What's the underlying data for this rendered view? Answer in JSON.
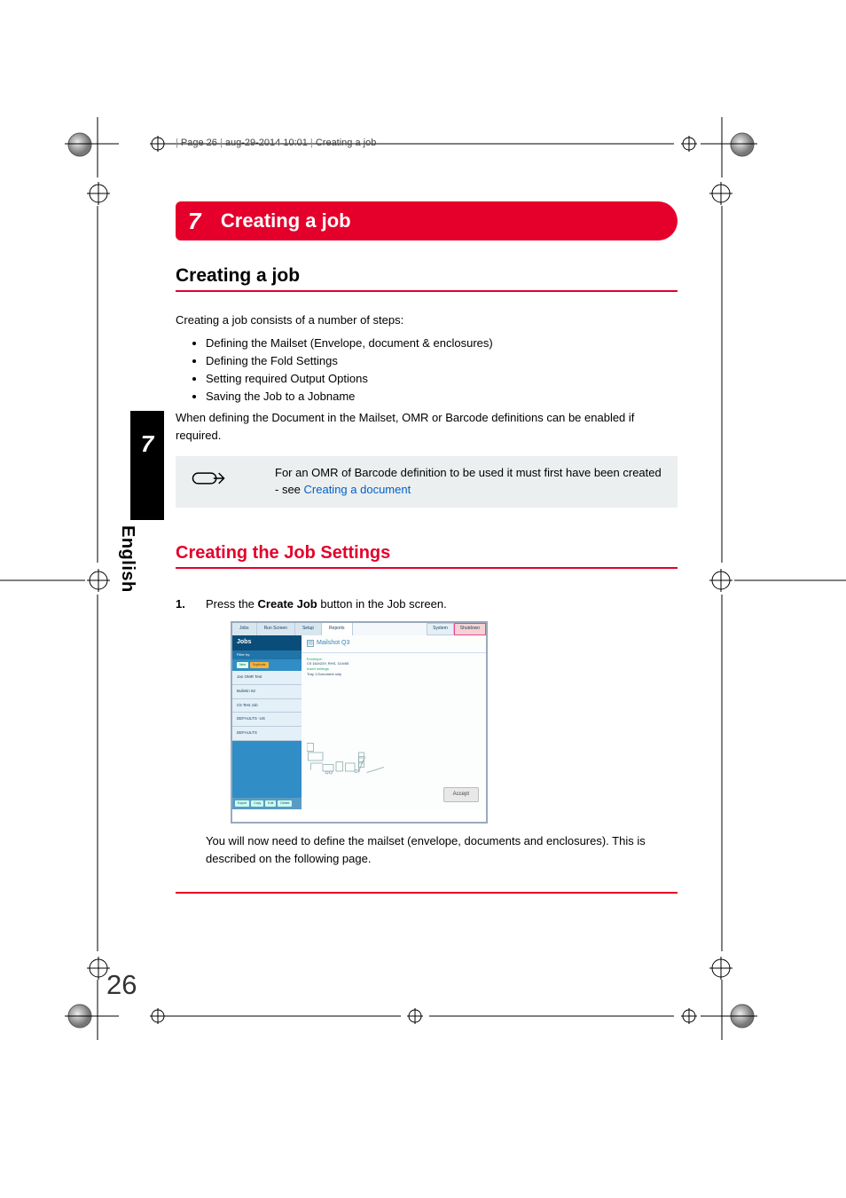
{
  "header": {
    "page": "Page 26",
    "date": "aug-29-2014 10:01",
    "title": "Creating a job",
    "sep": "|"
  },
  "chapter": {
    "num": "7",
    "title": "Creating a job"
  },
  "section1": {
    "heading": "Creating a job",
    "intro": "Creating a job consists of a number of steps:",
    "bullets": [
      "Defining the Mailset (Envelope, document & enclosures)",
      "Defining the Fold Settings",
      "Setting required Output Options",
      "Saving the Job to a Jobname"
    ],
    "after": "When defining the Document in the Mailset, OMR or Barcode definitions can be enabled if required."
  },
  "note": {
    "text": "For an OMR of Barcode definition to be used it must first have been created - see ",
    "link": "Creating a document"
  },
  "section2": {
    "heading": "Creating the Job Settings",
    "step_num": "1.",
    "step_pre": "Press the ",
    "step_bold": "Create Job",
    "step_post": " button in the Job screen.",
    "after": "You will now need to define the mailset (envelope, documents and enclosures). This is described on the following page."
  },
  "figure": {
    "tabs": [
      "Jobs",
      "Run Screen",
      "Setup",
      "Reports"
    ],
    "sys_btn": "System",
    "shut_btn": "Shutdown",
    "left": {
      "title": "Jobs",
      "filter": "Filter by:",
      "btn_new": "New",
      "btn_dup": "Duplicate",
      "items": [
        "Jan OMR Test",
        "Bulletin 62",
        "C5 Test Job",
        "DEFAULTS -US",
        "DEFAULTS"
      ],
      "foot": [
        "Export",
        "Copy",
        "Edit",
        "Delete"
      ]
    },
    "right": {
      "title": "Mailshot Q3",
      "meta_env": "Envelope:",
      "meta_env_v": "C5 162x229, RHS, 110x55",
      "meta_ins": "Insert settings",
      "meta_ins_v": "Tray 1    Document only",
      "accept": "Accept"
    }
  },
  "sidetab": {
    "num": "7",
    "lang": "English"
  },
  "page_number": "26"
}
